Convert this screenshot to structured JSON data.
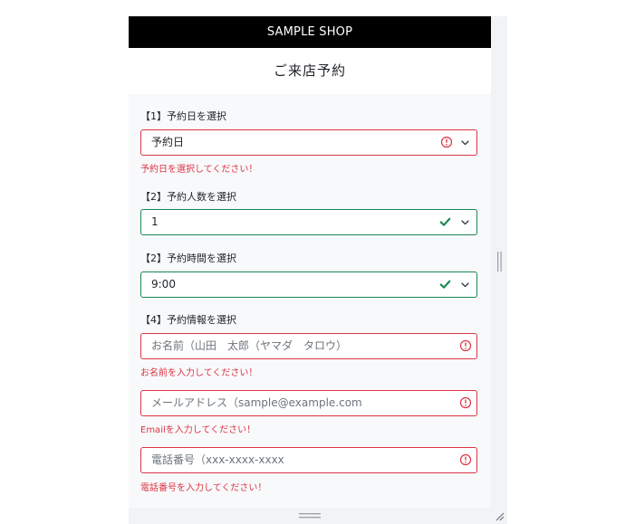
{
  "header": {
    "shop_name": "SAMPLE SHOP",
    "page_title": "ご来店予約"
  },
  "sections": {
    "date": {
      "label": "【1】予約日を選択",
      "value": "予約日",
      "error": "予約日を選択してください！"
    },
    "people": {
      "label": "【2】予約人数を選択",
      "value": "1"
    },
    "time": {
      "label": "【2】予約時間を選択",
      "value": "9:00"
    },
    "info": {
      "label": "【4】予約情報を選択",
      "name_placeholder": "お名前（山田　太郎（ヤマダ　タロウ）",
      "name_error": "お名前を入力してください！",
      "email_placeholder": "メールアドレス（sample@example.com",
      "email_error": "Emailを入力してください！",
      "phone_placeholder": "電話番号（xxx-xxxx-xxxx",
      "phone_error": "電話番号を入力してください！"
    }
  },
  "colors": {
    "invalid": "#dc3545",
    "valid": "#198754",
    "header_bg": "#000000",
    "form_bg": "#f8f9fa"
  },
  "icons": {
    "invalid": "exclamation-circle-icon",
    "valid": "check-icon",
    "dropdown": "chevron-down-icon"
  }
}
